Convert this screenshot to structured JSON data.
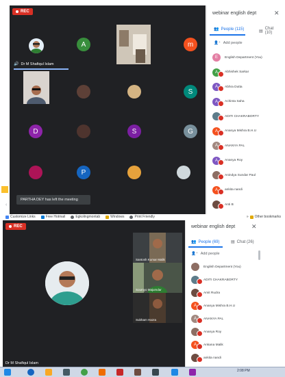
{
  "top": {
    "rec_label": "REC",
    "featured_name": "Dr M Shafiqul Islam",
    "avatars": {
      "a": "A",
      "m": "m",
      "s1": "S",
      "d": "D",
      "s2": "S",
      "g": "G",
      "p": "P"
    },
    "toast": "PARTHA DEY has left the meeting",
    "panel": {
      "title": "webinar english dept",
      "people_tab": "People (115)",
      "chat_tab": "Chat (10)",
      "add_people": "Add people",
      "participants": [
        {
          "initial": "E",
          "name": "English Department (You)",
          "color": "#e37ea3"
        },
        {
          "initial": "A",
          "name": "Abhishek Sarkar",
          "color": "#43a047"
        },
        {
          "initial": "A",
          "name": "Abhra Dutta",
          "color": "#7e57c2"
        },
        {
          "initial": "A",
          "name": "Achinta Saha",
          "color": "#7e57c2"
        },
        {
          "initial": "",
          "name": "ADITI CHAKRABORTY",
          "color": "#5d7c8a"
        },
        {
          "initial": "A",
          "name": "Ananya Mishra B.H.U",
          "color": "#f4511e"
        },
        {
          "initial": "A",
          "name": "ANANYA PAL",
          "color": "#a1887f"
        },
        {
          "initial": "A",
          "name": "Ananya Roy",
          "color": "#7e57c2"
        },
        {
          "initial": "",
          "name": "Anindya Sundar Paul",
          "color": "#8d6e63"
        },
        {
          "initial": "A",
          "name": "ankita nandi",
          "color": "#f4511e"
        },
        {
          "initial": "",
          "name": "Anti B",
          "color": "#6d4c41"
        }
      ]
    },
    "bookmarks": [
      "Customize Links",
      "Free Hotmail",
      "Egkolingmontab",
      "Windows",
      "Print Friendly"
    ],
    "other_bookmarks": "Other bookmarks"
  },
  "bottom": {
    "rec_label": "REC",
    "featured_name": "Dr M Shafiqul Islam",
    "thumbs": [
      "Santosh Kumar Malik",
      "Soumyo Majumdar",
      "Subham Hazra"
    ],
    "panel": {
      "title": "webinar english dept",
      "people_tab": "People (69)",
      "chat_tab": "Chat (26)",
      "add_people": "Add people",
      "participants": [
        {
          "initial": "",
          "name": "English Department (You)",
          "color": "#8d6e63"
        },
        {
          "initial": "",
          "name": "ADITI CHAKRABORTY",
          "color": "#5d7c8a"
        },
        {
          "initial": "",
          "name": "Amit Rudra",
          "color": "#6d4c41"
        },
        {
          "initial": "A",
          "name": "Ananya Mishra B.H.U",
          "color": "#f4511e"
        },
        {
          "initial": "A",
          "name": "ANANYA PAL",
          "color": "#a1887f"
        },
        {
          "initial": "",
          "name": "Ananya Roy",
          "color": "#8d6e63"
        },
        {
          "initial": "A",
          "name": "Ankana Malik",
          "color": "#f4511e"
        },
        {
          "initial": "",
          "name": "ankita nandi",
          "color": "#6d4c41"
        }
      ]
    },
    "clock": "2:08 PM"
  }
}
